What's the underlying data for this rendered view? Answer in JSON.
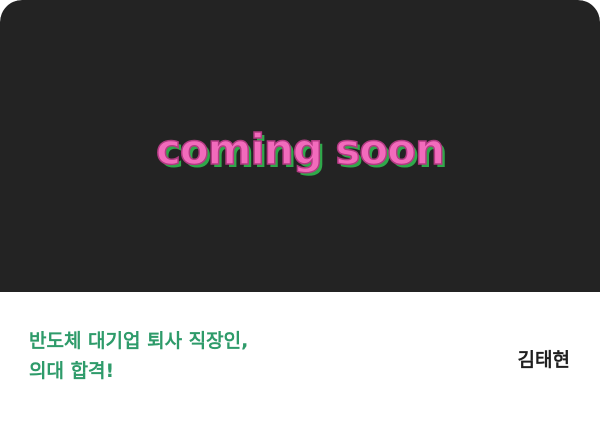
{
  "banner": {
    "text": "coming soon",
    "colors": {
      "background": "#232323",
      "text_fill": "#f26bbc",
      "text_shadow": "#2fa84a"
    }
  },
  "card": {
    "headline_lines": [
      "반도체 대기업 퇴사 직장인,",
      "의대 합격!"
    ],
    "author": "김태현",
    "colors": {
      "headline": "#2e9b6a",
      "author": "#1f1f1f",
      "background": "#ffffff"
    }
  }
}
